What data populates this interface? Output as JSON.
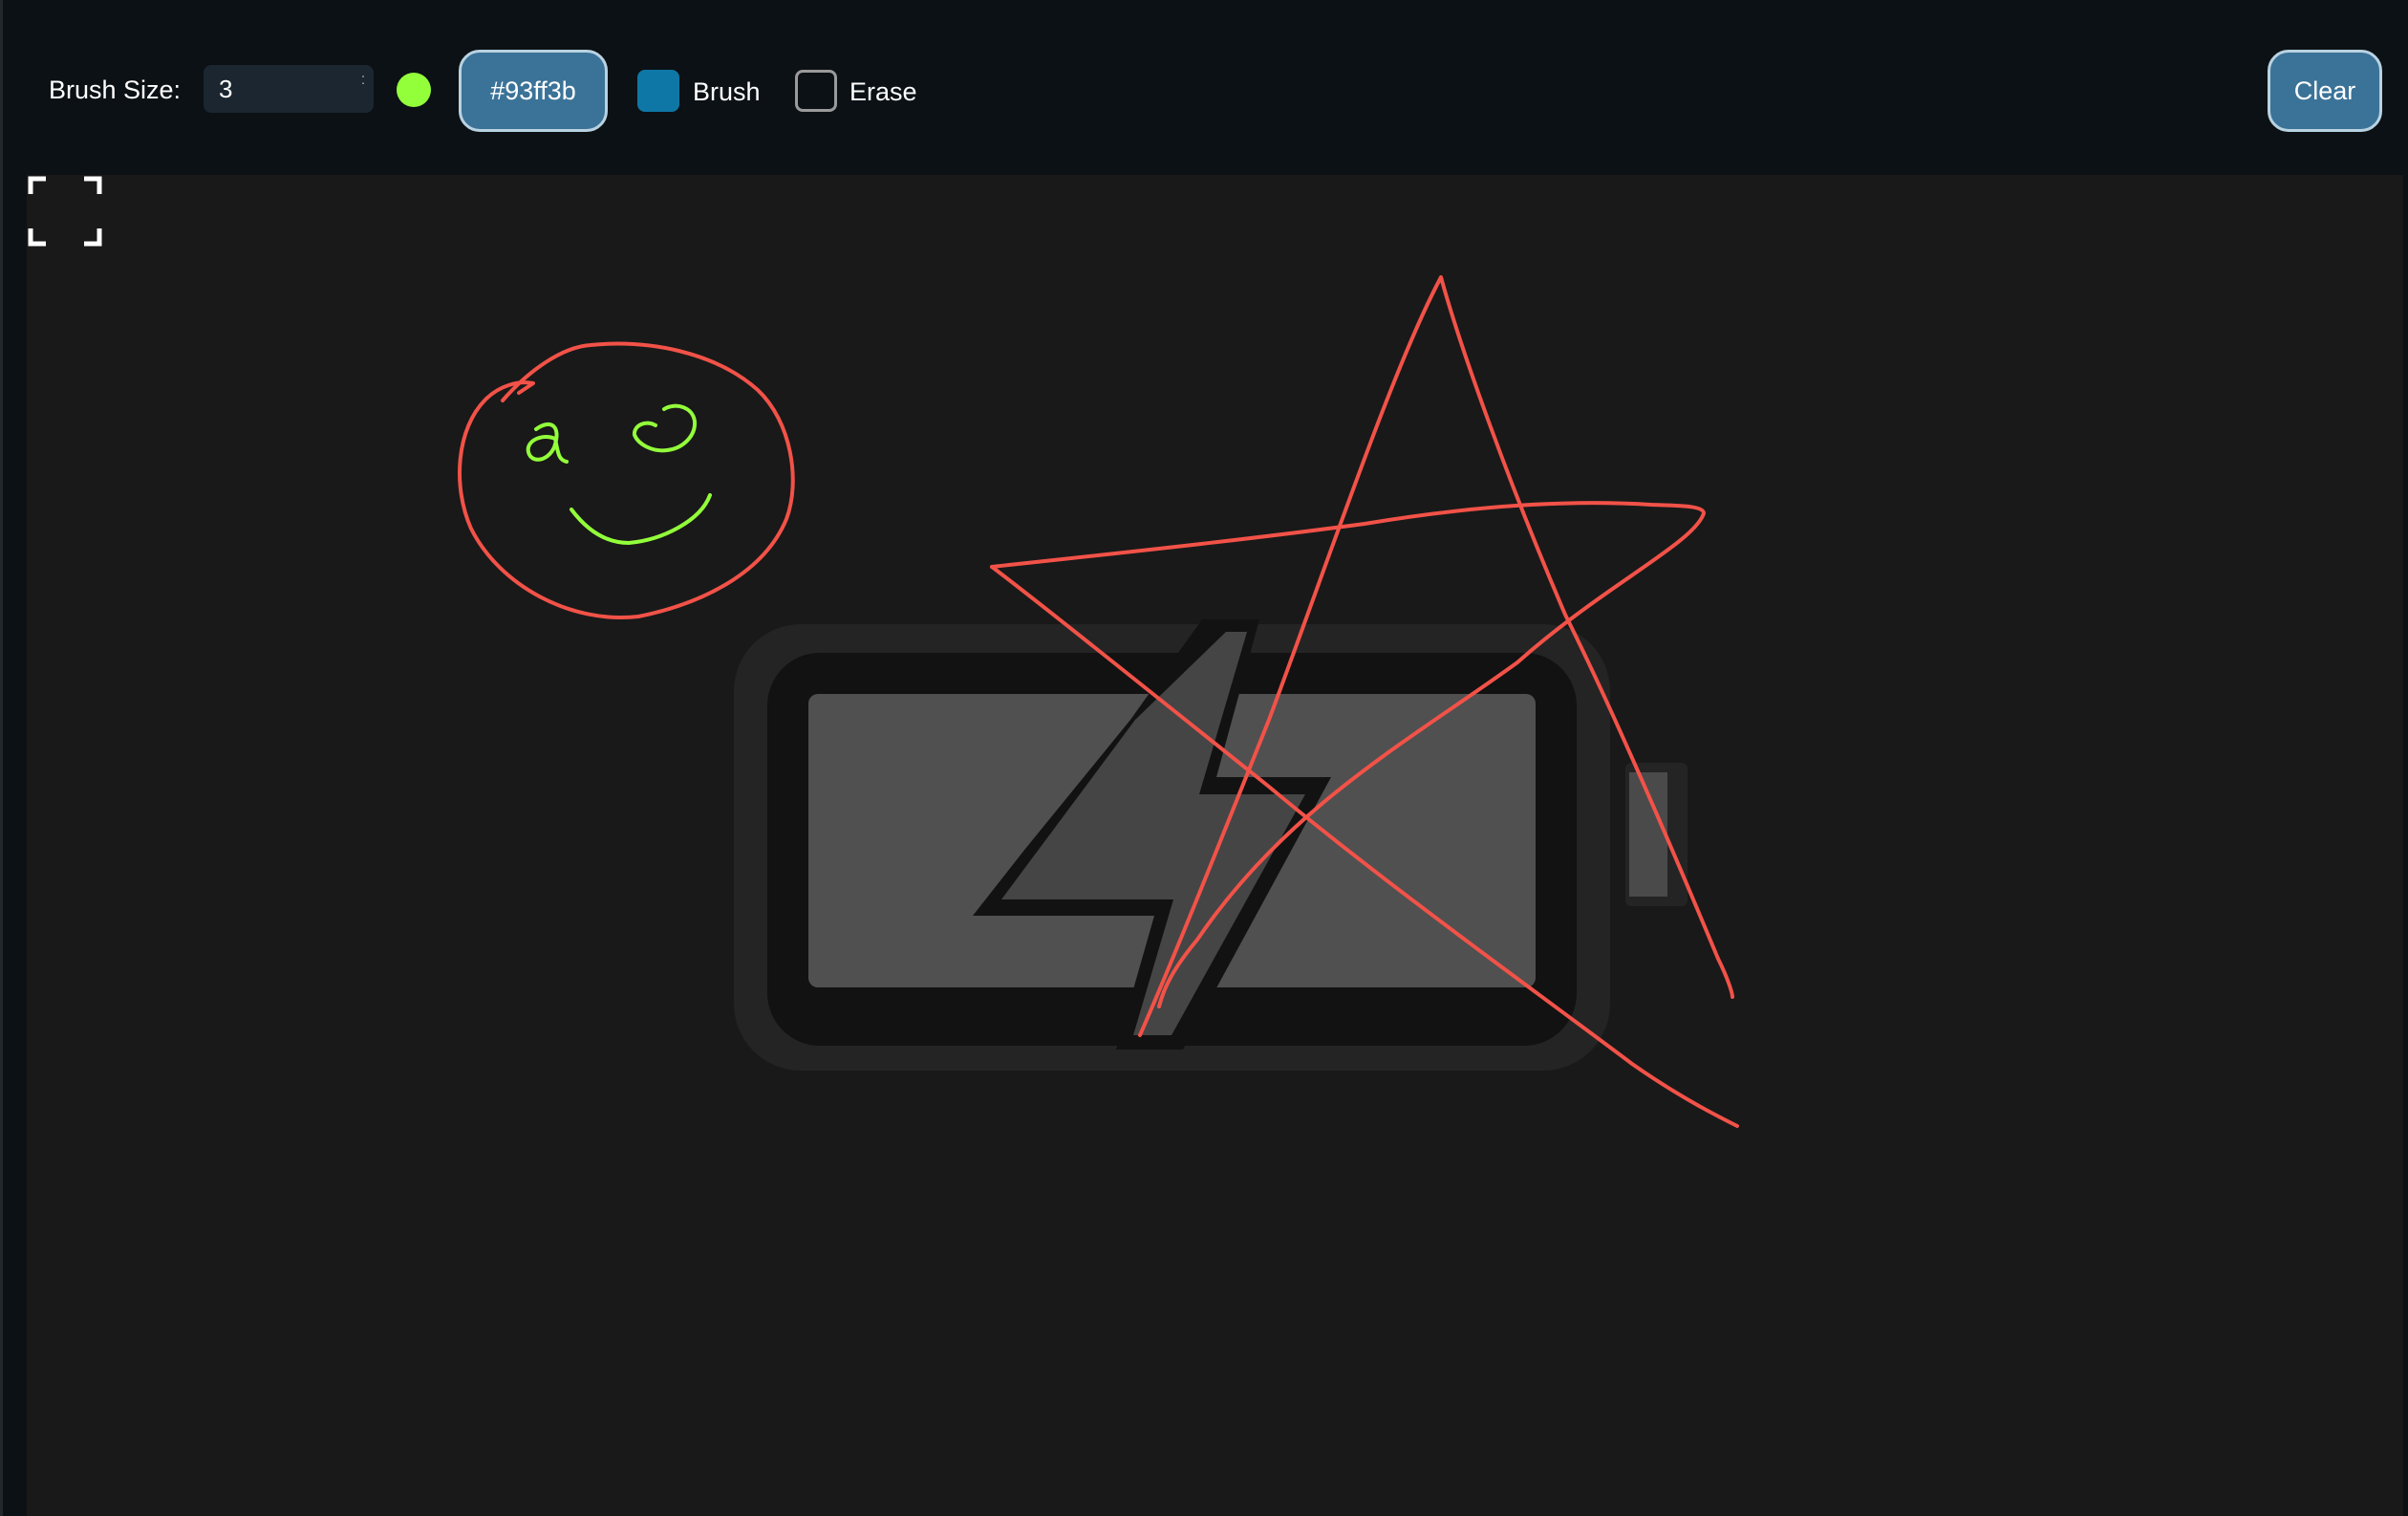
{
  "toolbar": {
    "brush_size_label": "Brush Size:",
    "brush_size_value": "3",
    "stepper_glyph": "⁚",
    "current_color_hex": "#93ff3b",
    "color_button_label": "#93ff3b",
    "brush_toggle": {
      "label": "Brush",
      "checked": true,
      "color": "#0e77a6"
    },
    "erase_toggle": {
      "label": "Erase",
      "checked": false
    },
    "clear_label": "Clear",
    "button_color": "#3b7398"
  },
  "canvas": {
    "background": "#191919",
    "background_image_icon": "battery-charging-icon",
    "stroke_colors": {
      "red": "#f25248",
      "green": "#93ff3b"
    },
    "fullscreen_icon": "fullscreen-icon"
  }
}
